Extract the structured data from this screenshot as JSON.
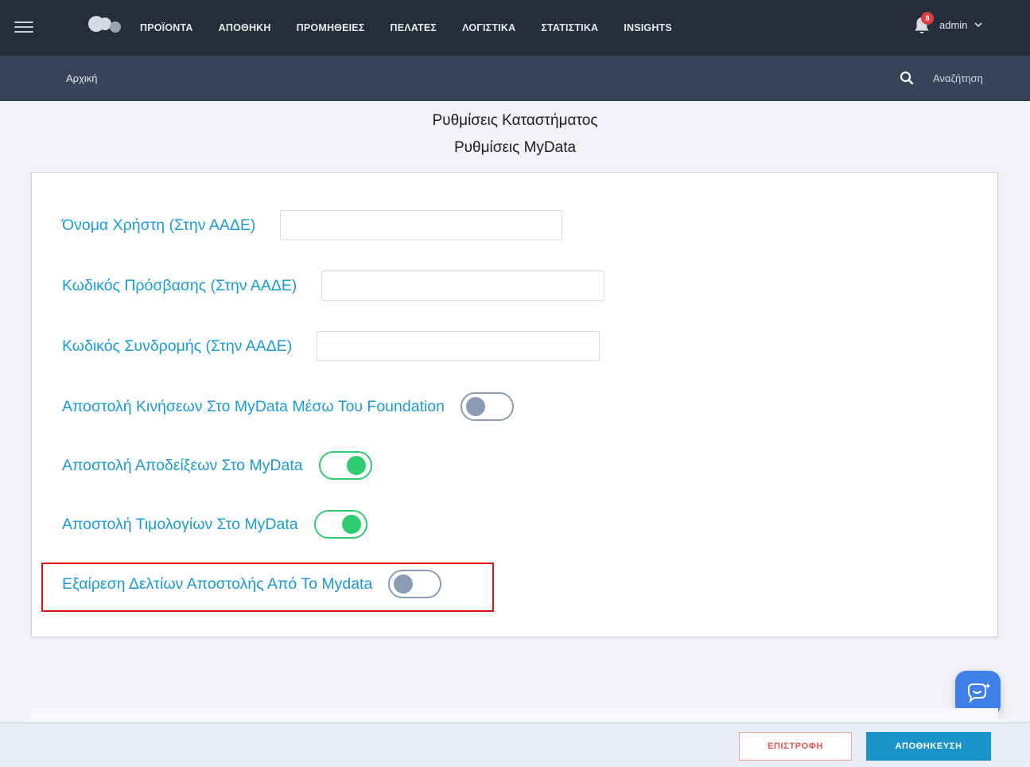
{
  "nav": {
    "items": [
      "ΠΡΟΪΟΝΤΑ",
      "ΑΠΟΘΗΚΗ",
      "ΠΡΟΜΗΘΕΙΕΣ",
      "ΠΕΛΑΤΕΣ",
      "ΛΟΓΙΣΤΙΚΑ",
      "ΣΤΑΤΙΣΤΙΚΑ",
      "INSIGHTS"
    ],
    "notification_count": "8",
    "user": "admin"
  },
  "subbar": {
    "breadcrumb": "Αρχική",
    "search_label": "Αναζήτηση"
  },
  "page": {
    "title": "Ρυθμίσεις Καταστήματος",
    "subtitle": "Ρυθμίσεις MyData"
  },
  "form": {
    "username_label": "Όνομα Χρήστη (Στην ΑΑΔΕ)",
    "username_value": "",
    "password_label": "Κωδικός Πρόσβασης (Στην ΑΑΔΕ)",
    "password_value": "",
    "subscription_label": "Κωδικός Συνδρομής (Στην ΑΑΔΕ)",
    "subscription_value": "",
    "toggles": [
      {
        "label": "Αποστολή Κινήσεων Στο MyData Μέσω Του Foundation",
        "on": false
      },
      {
        "label": "Αποστολή Αποδείξεων Στο MyData",
        "on": true
      },
      {
        "label": "Αποστολή Τιμολογίων Στο MyData",
        "on": true
      },
      {
        "label": "Εξαίρεση Δελτίων Αποστολής Από Το Mydata",
        "on": false
      }
    ]
  },
  "footer": {
    "back_label": "ΕΠΙΣΤΡΟΦΗ",
    "save_label": "ΑΠΟΘΗΚΕΥΣΗ"
  },
  "colors": {
    "topbar": "#242d3a",
    "subbar": "#374457",
    "label": "#1a9bd1",
    "toggle_on": "#2ecc71",
    "toggle_off": "#8a9bb3",
    "highlight": "#e01414",
    "save_button": "#1a93c9"
  },
  "icons": [
    "hamburger-icon",
    "logo-icon",
    "bell-icon",
    "chevron-down-icon",
    "search-icon",
    "chat-icon"
  ]
}
